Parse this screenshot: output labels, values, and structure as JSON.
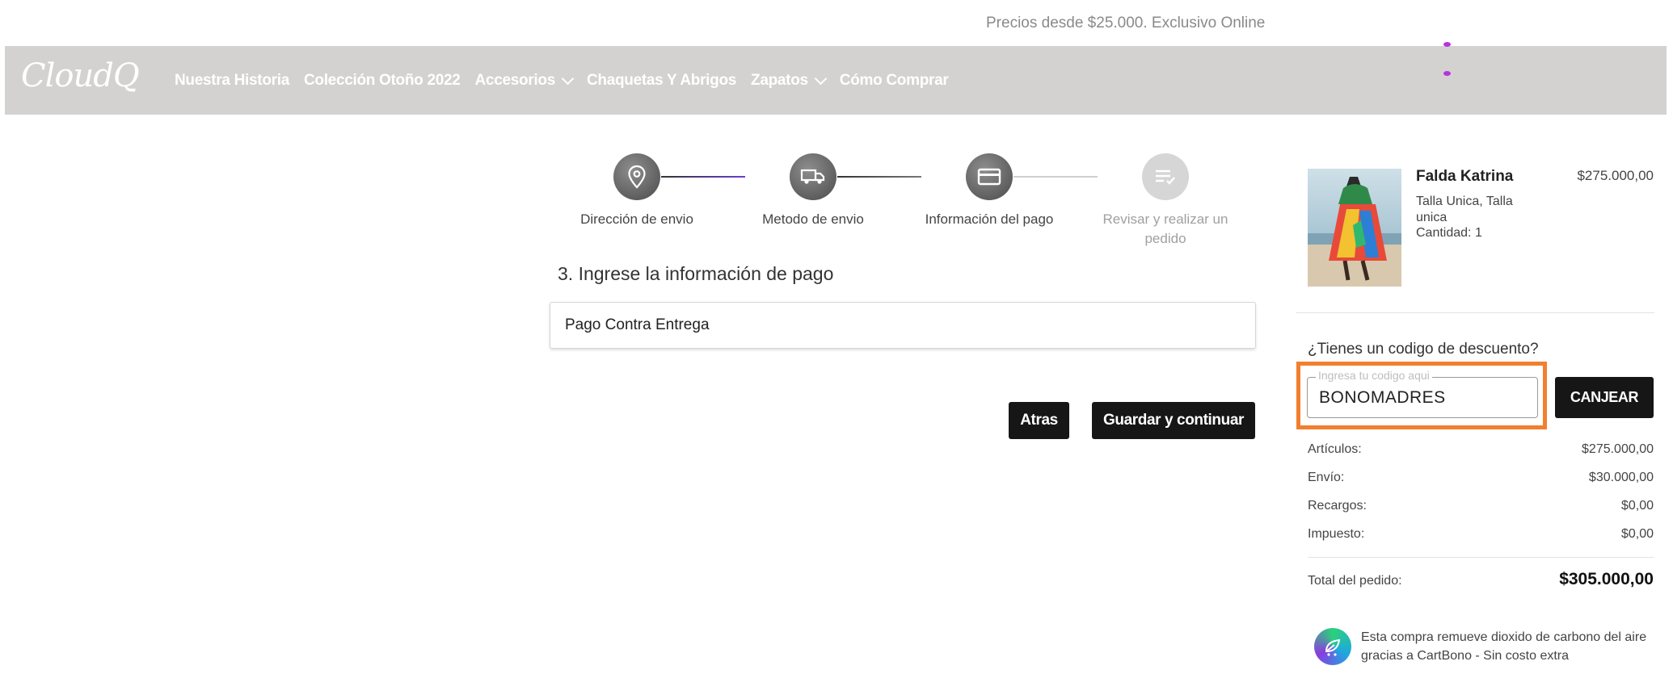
{
  "promo_banner": "Precios desde $25.000. Exclusivo Online",
  "brand": {
    "logo_text": "CloudQ"
  },
  "nav": {
    "items": [
      {
        "label": "Nuestra Historia",
        "has_dropdown": false
      },
      {
        "label": "Colección Otoño 2022",
        "has_dropdown": false
      },
      {
        "label": "Accesorios",
        "has_dropdown": true
      },
      {
        "label": "Chaquetas Y Abrigos",
        "has_dropdown": false
      },
      {
        "label": "Zapatos",
        "has_dropdown": true
      },
      {
        "label": "Cómo Comprar",
        "has_dropdown": false
      }
    ]
  },
  "stepper": {
    "steps": [
      {
        "label": "Dirección de envio",
        "icon": "map-pin-icon",
        "state": "done"
      },
      {
        "label": "Metodo de envio",
        "icon": "truck-icon",
        "state": "done"
      },
      {
        "label": "Información del pago",
        "icon": "credit-card-icon",
        "state": "current"
      },
      {
        "label": "Revisar y realizar un pedido",
        "icon": "list-check-icon",
        "state": "pending"
      }
    ]
  },
  "checkout": {
    "section_title": "3. Ingrese la información de pago",
    "payment_method": "Pago Contra Entrega",
    "back_label": "Atras",
    "continue_label": "Guardar y continuar"
  },
  "cart": {
    "product": {
      "name": "Falda Katrina",
      "price": "$275.000,00",
      "variant": "Talla Unica, Talla unica",
      "quantity": "Cantidad: 1"
    },
    "discount": {
      "title": "¿Tienes un codigo de descuento?",
      "placeholder": "Ingresa tu codigo aqui",
      "value": "BONOMADRES",
      "redeem_label": "CANJEAR"
    },
    "summary": {
      "items_label": "Artículos:",
      "items_value": "$275.000,00",
      "shipping_label": "Envío:",
      "shipping_value": "$30.000,00",
      "surcharge_label": "Recargos:",
      "surcharge_value": "$0,00",
      "tax_label": "Impuesto:",
      "tax_value": "$0,00",
      "total_label": "Total del pedido:",
      "total_value": "$305.000,00"
    },
    "eco_note": "Esta compra remueve dioxido de carbono del aire gracias a CartBono - Sin costo extra"
  },
  "colors": {
    "navbar_bg": "#d3d2d0",
    "accent_purple": "#6a3fd1",
    "highlight_orange": "#f37f2e",
    "button_bg": "#161616"
  }
}
